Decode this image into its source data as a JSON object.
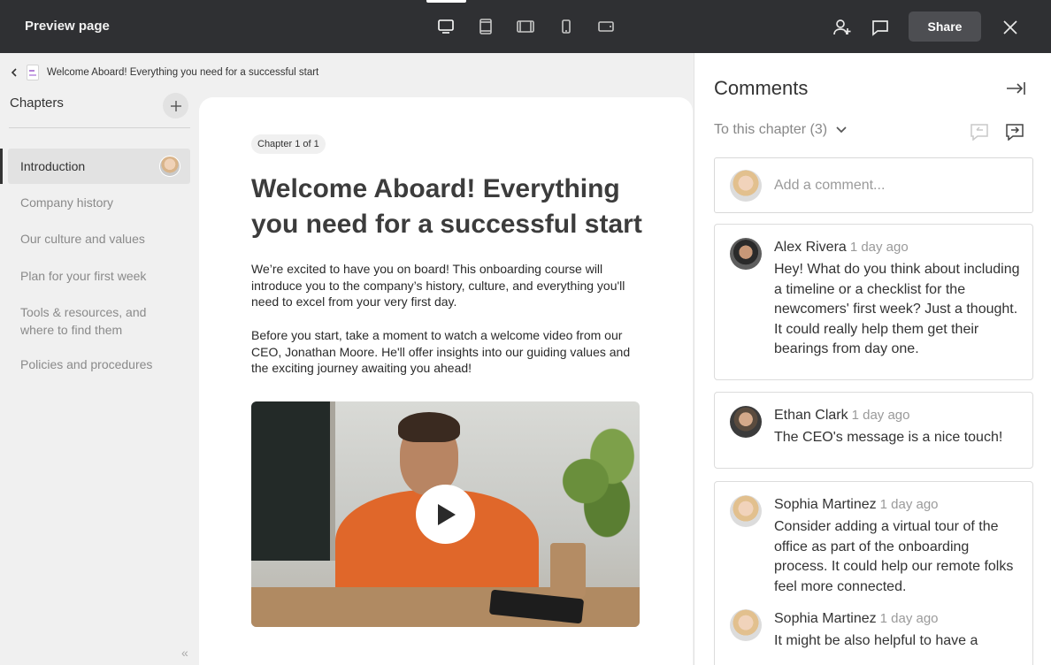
{
  "topbar": {
    "title": "Preview page",
    "devices": [
      {
        "name": "desktop-icon",
        "active": true
      },
      {
        "name": "tablet-portrait-icon",
        "active": false
      },
      {
        "name": "tablet-landscape-icon",
        "active": false
      },
      {
        "name": "phone-portrait-icon",
        "active": false
      },
      {
        "name": "phone-landscape-icon",
        "active": false
      }
    ],
    "share_label": "Share"
  },
  "breadcrumb": {
    "page_title": "Welcome Aboard! Everything you need for a successful start"
  },
  "sidebar": {
    "heading": "Chapters",
    "items": [
      {
        "label": "Introduction",
        "active": true
      },
      {
        "label": "Company history",
        "active": false
      },
      {
        "label": "Our culture and values",
        "active": false
      },
      {
        "label": "Plan for your first week",
        "active": false
      },
      {
        "label": "Tools & resources, and where to find them",
        "active": false
      },
      {
        "label": "Policies and procedures",
        "active": false
      }
    ]
  },
  "main": {
    "chapter_badge": "Chapter 1 of 1",
    "title": "Welcome Aboard! Everything you need for a successful start",
    "paragraphs": [
      "We’re excited to have you on board! This onboarding course will introduce you to the company’s history, culture, and everything you'll need to excel from your very first day.",
      "Before you start, take a moment to watch a welcome video from our CEO, Jonathan Moore. He'll offer insights into our guiding values and the exciting journey awaiting you ahead!"
    ]
  },
  "comments": {
    "heading": "Comments",
    "filter_label": "To this chapter (3)",
    "add_placeholder": "Add a comment...",
    "threads": [
      {
        "author": "Alex Rivera",
        "time": "1 day ago",
        "text": "Hey! What do you think about including a timeline or a checklist for the newcomers' first week? Just a thought. It could really help them get their bearings from day one."
      },
      {
        "author": "Ethan Clark",
        "time": "1 day ago",
        "text": "The CEO's message is a nice touch!"
      },
      {
        "author": "Sophia Martinez",
        "time": "1 day ago",
        "text": "Consider adding a virtual tour of the office as part of the onboarding process. It could help our remote folks feel more connected."
      },
      {
        "author": "Sophia Martinez",
        "time": "1 day ago",
        "text": "It might be also helpful to have a"
      }
    ]
  },
  "colors": {
    "topbar_bg": "#2f3033",
    "share_bg": "#4d4e52",
    "sidebar_bg": "#f0f0f0",
    "active_item_bg": "#e2e2e2",
    "accent_orange": "#e0672a"
  }
}
